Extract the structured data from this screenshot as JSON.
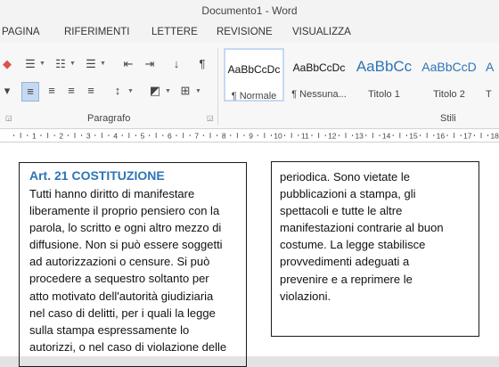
{
  "window": {
    "title": "Documento1 - Word"
  },
  "tabs": [
    "PAGINA",
    "RIFERIMENTI",
    "LETTERE",
    "REVISIONE",
    "VISUALIZZA"
  ],
  "ribbon": {
    "groups": {
      "paragraph": "Paragrafo",
      "styles": "Stili"
    },
    "styles": [
      {
        "sample": "AaBbCcDc",
        "name": "¶ Normale",
        "selected": true
      },
      {
        "sample": "AaBbCcDc",
        "name": "¶ Nessuna..."
      },
      {
        "sample": "AaBbCc",
        "name": "Titolo 1"
      },
      {
        "sample": "AaBbCcD",
        "name": "Titolo 2"
      },
      {
        "sample": "A",
        "name": "T"
      }
    ],
    "icons": [
      "eraser-icon",
      "bullets-icon",
      "numbering-icon",
      "multilevel-list-icon",
      "decrease-indent-icon",
      "increase-indent-icon",
      "sort-icon",
      "pilcrow-icon",
      "align-left-icon",
      "align-center-icon",
      "align-right-icon",
      "justify-icon",
      "line-spacing-icon",
      "shading-icon",
      "borders-icon"
    ]
  },
  "ruler": {
    "labels": [
      "1",
      "2",
      "3",
      "4",
      "5",
      "6",
      "7",
      "8",
      "9",
      "10",
      "11",
      "12",
      "13",
      "14",
      "15",
      "16",
      "17",
      "18"
    ]
  },
  "document": {
    "heading": "Art. 21 COSTITUZIONE",
    "col1_lines": [
      "Tutti hanno diritto di manifestare",
      "liberamente il proprio pensiero con la",
      "parola, lo scritto e ogni altro mezzo di",
      "diffusione. Non si può essere soggetti",
      "ad autorizzazioni o censure. Si può",
      "procedere a sequestro soltanto per",
      "atto motivato dell'autorità giudiziaria",
      "nel caso di delitti, per i quali la legge",
      "sulla stampa espressamente lo",
      "autorizzi, o nel caso di violazione delle"
    ],
    "col2_lines": [
      "periodica. Sono vietate le",
      "pubblicazioni a stampa, gli",
      "spettacoli e tutte le altre",
      "manifestazioni contrarie al buon",
      "costume. La legge stabilisce",
      "provvedimenti adeguati a",
      "prevenire e a reprimere le",
      "violazioni."
    ]
  },
  "colors": {
    "heading": "#2e74b5",
    "titolo": "#2e74b5",
    "ribbon_bg": "#f7f7f7",
    "selected_style_border": "#c5d9f1"
  }
}
